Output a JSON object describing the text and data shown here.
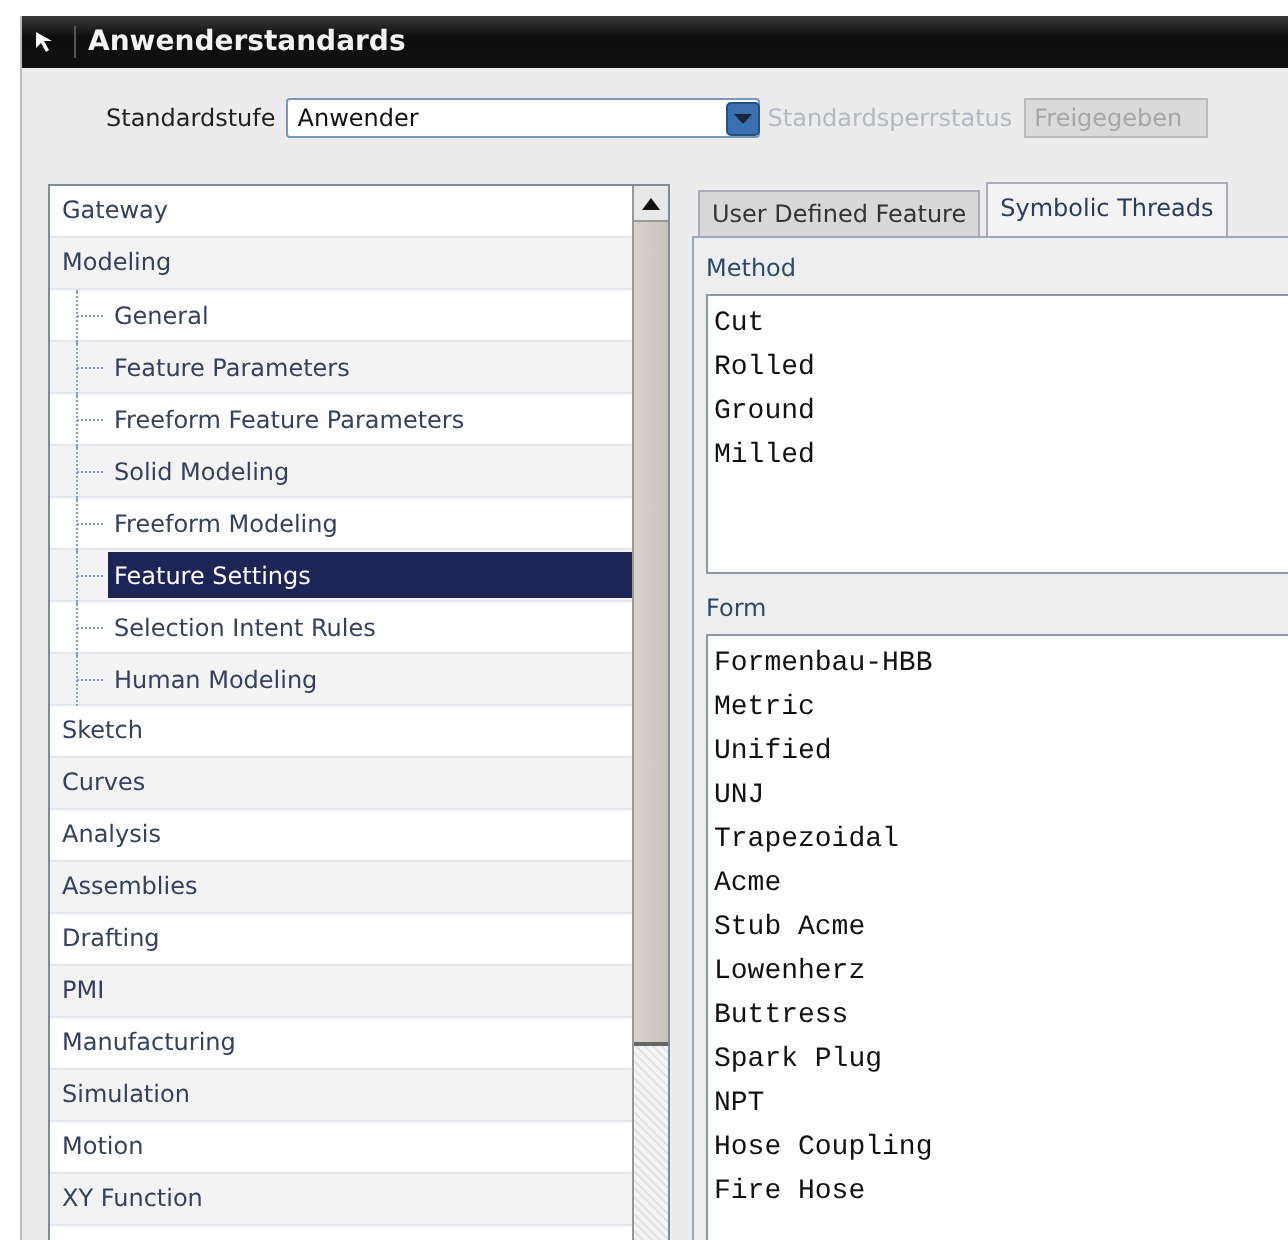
{
  "window": {
    "title": "Anwenderstandards"
  },
  "toolbar": {
    "level_label": "Standardstufe",
    "level_value": "Anwender",
    "lock_label": "Standardsperrstatus",
    "lock_value": "Freigegeben",
    "lock_disabled": true
  },
  "tree": {
    "items": [
      {
        "label": "Gateway",
        "selected": false
      },
      {
        "label": "Modeling",
        "selected": false,
        "children": [
          {
            "label": "General",
            "selected": false
          },
          {
            "label": "Feature Parameters",
            "selected": false
          },
          {
            "label": "Freeform Feature Parameters",
            "selected": false
          },
          {
            "label": "Solid Modeling",
            "selected": false
          },
          {
            "label": "Freeform Modeling",
            "selected": false
          },
          {
            "label": "Feature Settings",
            "selected": true
          },
          {
            "label": "Selection Intent Rules",
            "selected": false
          },
          {
            "label": "Human Modeling",
            "selected": false
          }
        ]
      },
      {
        "label": "Sketch",
        "selected": false
      },
      {
        "label": "Curves",
        "selected": false
      },
      {
        "label": "Analysis",
        "selected": false
      },
      {
        "label": "Assemblies",
        "selected": false
      },
      {
        "label": "Drafting",
        "selected": false
      },
      {
        "label": "PMI",
        "selected": false
      },
      {
        "label": "Manufacturing",
        "selected": false
      },
      {
        "label": "Simulation",
        "selected": false
      },
      {
        "label": "Motion",
        "selected": false
      },
      {
        "label": "XY Function",
        "selected": false
      }
    ]
  },
  "tabs": [
    {
      "label": "User Defined Feature",
      "selected": false
    },
    {
      "label": "Symbolic Threads",
      "selected": true
    }
  ],
  "method": {
    "label": "Method",
    "items": [
      "Cut",
      "Rolled",
      "Ground",
      "Milled"
    ]
  },
  "form": {
    "label": "Form",
    "items": [
      "Formenbau-HBB",
      "Metric",
      "Unified",
      "UNJ",
      "Trapezoidal",
      "Acme",
      "Stub Acme",
      "Lowenherz",
      "Buttress",
      "Spark Plug",
      "NPT",
      "Hose Coupling",
      "Fire Hose"
    ]
  }
}
